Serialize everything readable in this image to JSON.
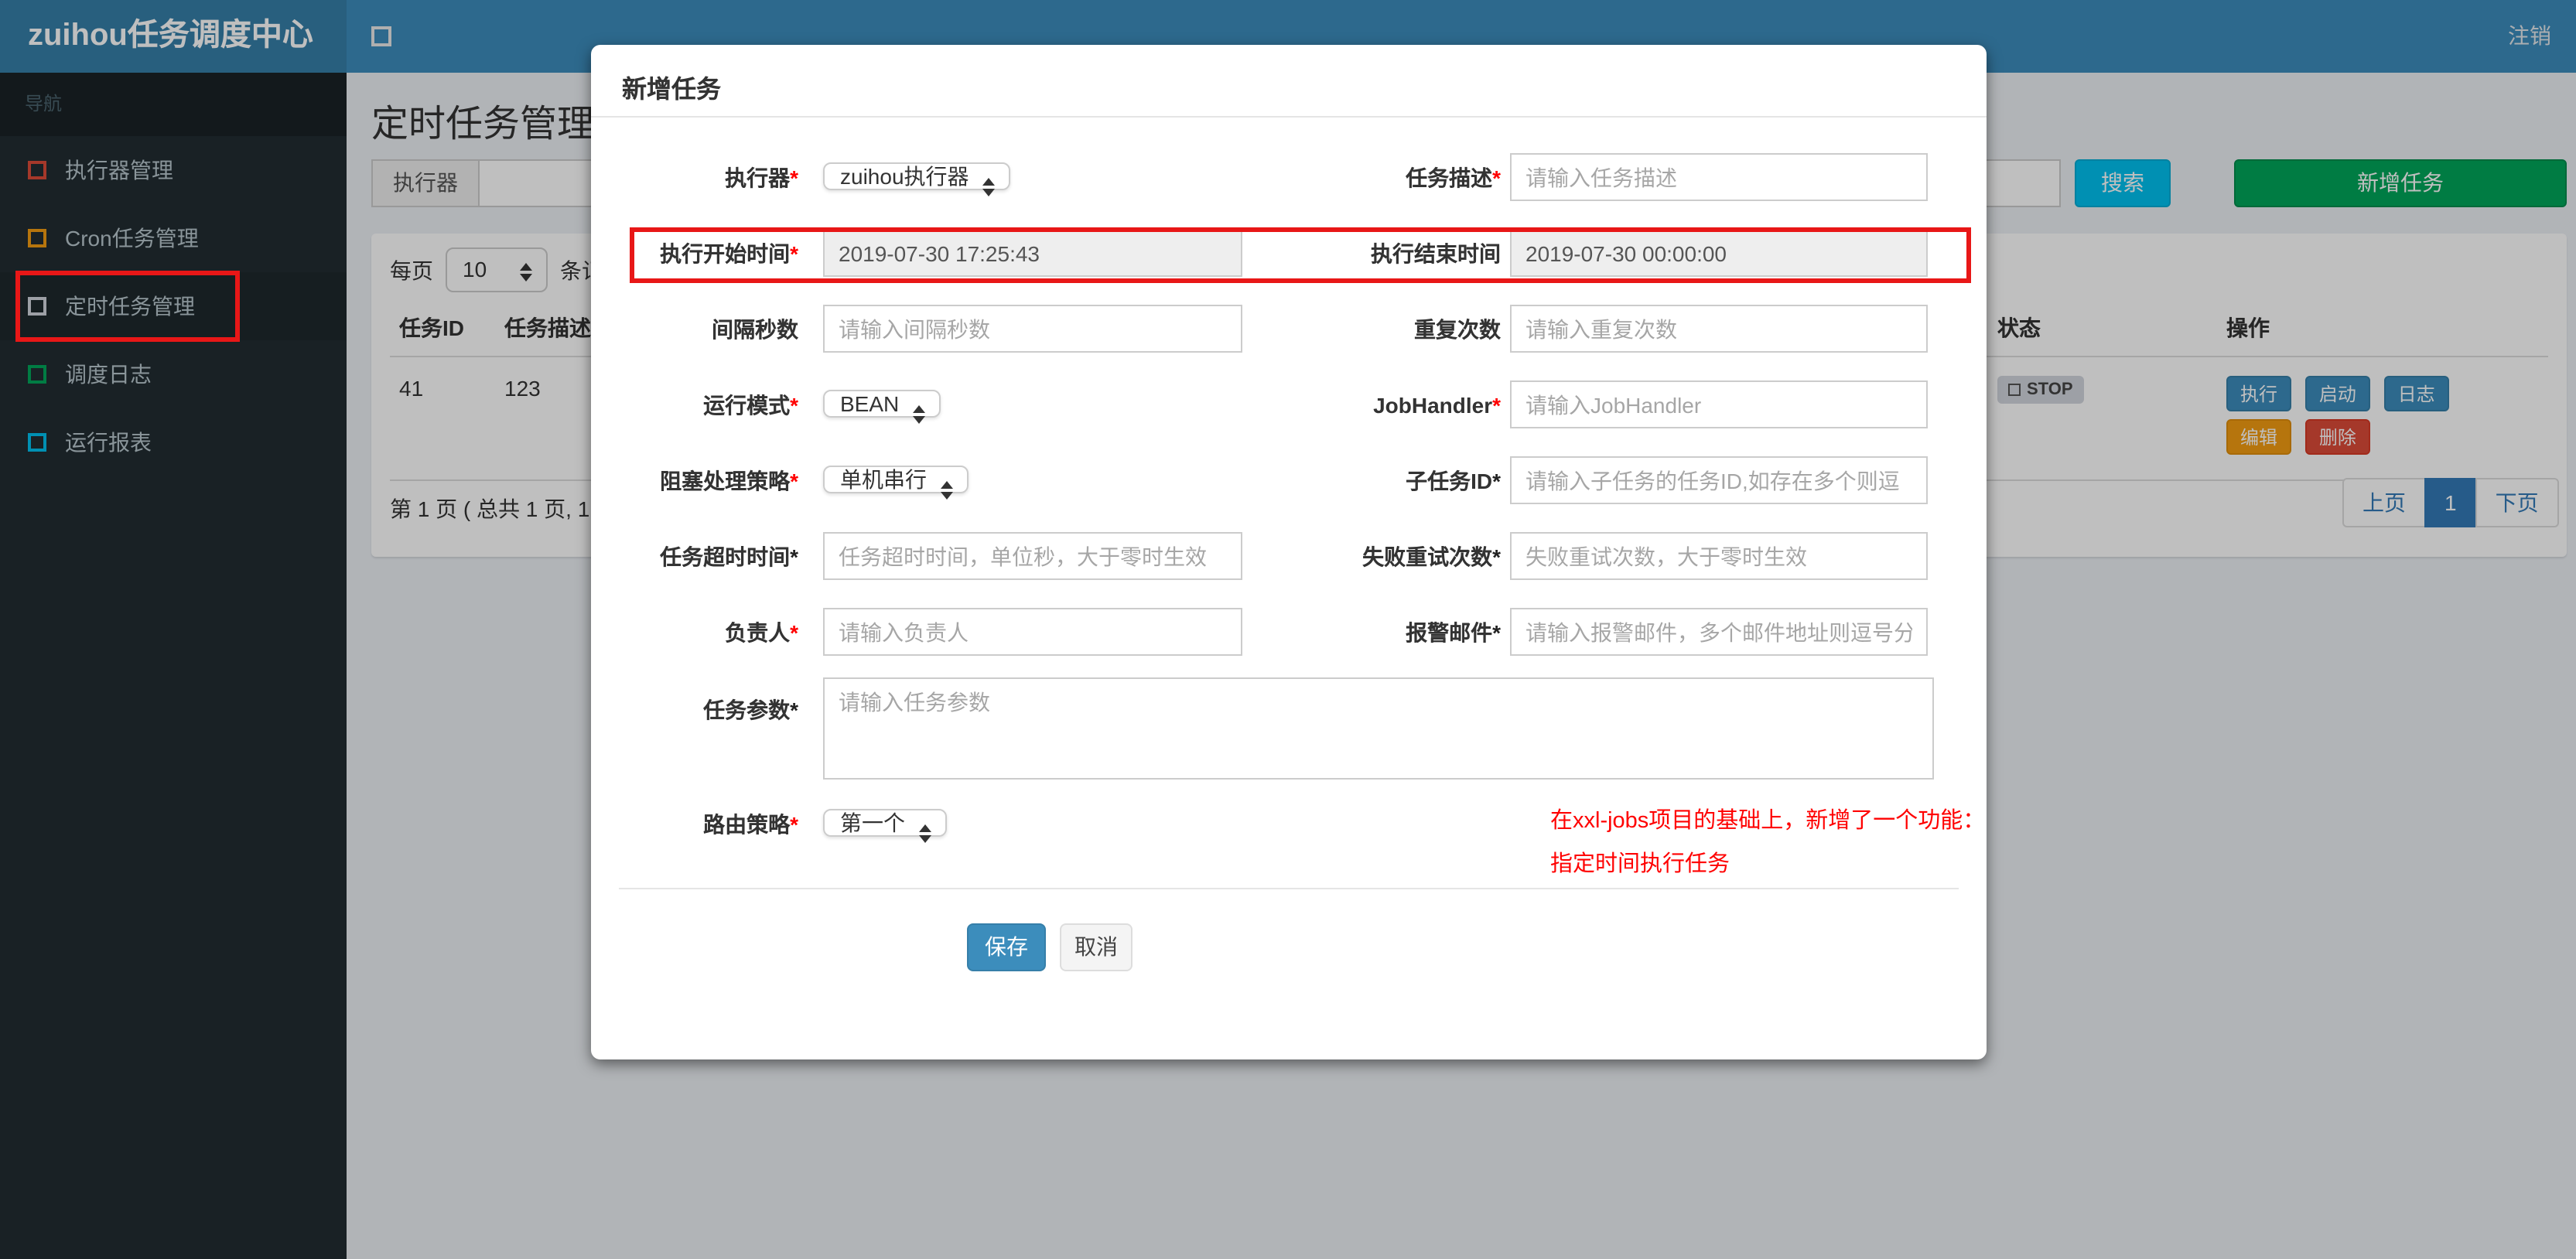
{
  "app": {
    "brand": "zuihou任务调度中心",
    "logout": "注销"
  },
  "colors": {
    "navbar": "#3c8dbc",
    "brand_bg": "#367fa9",
    "sidebar_bg": "#222d32",
    "primary": "#3c8dbc",
    "info": "#00c0ef",
    "success": "#00a65a",
    "warning": "#f39c12",
    "danger": "#dd4b39",
    "pagination_active": "#337ab7",
    "annotation_red": "#e81717",
    "note_red": "#ff0000",
    "disabled_input_bg": "#eeeeee"
  },
  "sidebar": {
    "section_label": "导航",
    "items": [
      {
        "label": "执行器管理",
        "icon": "square-outline-icon",
        "icon_color": "#dd4b39"
      },
      {
        "label": "Cron任务管理",
        "icon": "square-outline-icon",
        "icon_color": "#f39c12"
      },
      {
        "label": "定时任务管理",
        "icon": "square-outline-icon",
        "icon_color": "#d2d6de",
        "highlighted": true
      },
      {
        "label": "调度日志",
        "icon": "square-outline-icon",
        "icon_color": "#00a65a"
      },
      {
        "label": "运行报表",
        "icon": "square-outline-icon",
        "icon_color": "#00c0ef"
      }
    ]
  },
  "page": {
    "title": "定时任务管理",
    "filter": {
      "executor_addon": "执行器",
      "search_button": "搜索",
      "add_button": "新增任务"
    },
    "per_page": {
      "label": "每页",
      "value": "10",
      "suffix": "条记录"
    },
    "table": {
      "headers": [
        "任务ID",
        "任务描述",
        "状态",
        "操作"
      ],
      "row": {
        "job_id": "41",
        "job_desc": "123",
        "status": "STOP"
      },
      "ops": [
        "执行",
        "启动",
        "日志",
        "编辑",
        "删除"
      ]
    },
    "pagination": {
      "info": "第 1 页 ( 总共 1 页, 1",
      "prev": "上页",
      "current": "1",
      "next": "下页"
    }
  },
  "modal": {
    "title": "新增任务",
    "rows": {
      "executor": {
        "label": "执行器",
        "required": "*",
        "value": "zuihou执行器"
      },
      "job_desc": {
        "label": "任务描述",
        "required": "*",
        "placeholder": "请输入任务描述"
      },
      "start_time": {
        "label": "执行开始时间",
        "required": "*",
        "value": "2019-07-30 17:25:43"
      },
      "end_time": {
        "label": "执行结束时间",
        "value": "2019-07-30 00:00:00"
      },
      "interval": {
        "label": "间隔秒数",
        "placeholder": "请输入间隔秒数"
      },
      "repeat": {
        "label": "重复次数",
        "placeholder": "请输入重复次数"
      },
      "glue_type": {
        "label": "运行模式",
        "required": "*",
        "value": "BEAN"
      },
      "job_handler": {
        "label": "JobHandler",
        "required": "*",
        "placeholder": "请输入JobHandler"
      },
      "block_strategy": {
        "label": "阻塞处理策略",
        "required": "*",
        "value": "单机串行"
      },
      "child_job": {
        "label": "子任务ID",
        "required": "*",
        "placeholder": "请输入子任务的任务ID,如存在多个则逗"
      },
      "timeout": {
        "label": "任务超时时间",
        "required": "*",
        "placeholder": "任务超时时间，单位秒，大于零时生效"
      },
      "retry": {
        "label": "失败重试次数",
        "required": "*",
        "placeholder": "失败重试次数，大于零时生效"
      },
      "owner": {
        "label": "负责人",
        "required": "*",
        "placeholder": "请输入负责人"
      },
      "alarm_email": {
        "label": "报警邮件",
        "required": "*",
        "placeholder": "请输入报警邮件，多个邮件地址则逗号分"
      },
      "job_param": {
        "label": "任务参数",
        "required": "*",
        "placeholder": "请输入任务参数"
      },
      "route_strategy": {
        "label": "路由策略",
        "required": "*",
        "value": "第一个"
      }
    },
    "note": {
      "line1": "在xxl-jobs项目的基础上，新增了一个功能：",
      "line2": "指定时间执行任务"
    },
    "save_label": "保存",
    "cancel_label": "取消"
  }
}
